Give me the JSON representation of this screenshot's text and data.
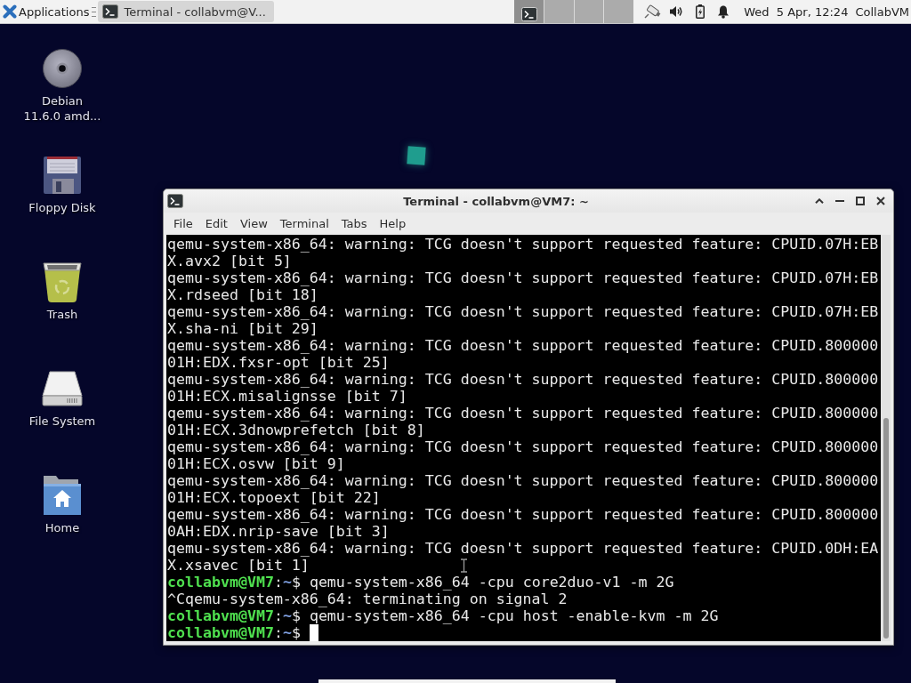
{
  "panel": {
    "menu": "Applications",
    "tasks": [
      {
        "label": "Terminal - collabvm@V...",
        "selected": true
      }
    ],
    "workspaces": [
      {
        "selected": true,
        "has_window": true
      },
      {
        "selected": false,
        "has_window": false
      },
      {
        "selected": false,
        "has_window": false
      },
      {
        "selected": false,
        "has_window": false
      }
    ],
    "clock": "Wed  5 Apr, 12:24",
    "user": "CollabVM"
  },
  "desktop_icons": [
    {
      "label": "Debian 11.6.0 amd...",
      "kind": "disc"
    },
    {
      "label": "Floppy Disk",
      "kind": "floppy"
    },
    {
      "label": "Trash",
      "kind": "trash"
    },
    {
      "label": "File System",
      "kind": "drive"
    },
    {
      "label": "Home",
      "kind": "home"
    }
  ],
  "terminal": {
    "title": "Terminal - collabvm@VM7: ~",
    "menu": [
      "File",
      "Edit",
      "View",
      "Terminal",
      "Tabs",
      "Help"
    ],
    "cursor": true,
    "lines": [
      {
        "kind": "output",
        "text": "qemu-system-x86_64: warning: TCG doesn't support requested feature: CPUID.07H:EB"
      },
      {
        "kind": "output",
        "text": "X.avx2 [bit 5]"
      },
      {
        "kind": "output",
        "text": "qemu-system-x86_64: warning: TCG doesn't support requested feature: CPUID.07H:EB"
      },
      {
        "kind": "output",
        "text": "X.rdseed [bit 18]"
      },
      {
        "kind": "output",
        "text": "qemu-system-x86_64: warning: TCG doesn't support requested feature: CPUID.07H:EB"
      },
      {
        "kind": "output",
        "text": "X.sha-ni [bit 29]"
      },
      {
        "kind": "output",
        "text": "qemu-system-x86_64: warning: TCG doesn't support requested feature: CPUID.800000"
      },
      {
        "kind": "output",
        "text": "01H:EDX.fxsr-opt [bit 25]"
      },
      {
        "kind": "output",
        "text": "qemu-system-x86_64: warning: TCG doesn't support requested feature: CPUID.800000"
      },
      {
        "kind": "output",
        "text": "01H:ECX.misalignsse [bit 7]"
      },
      {
        "kind": "output",
        "text": "qemu-system-x86_64: warning: TCG doesn't support requested feature: CPUID.800000"
      },
      {
        "kind": "output",
        "text": "01H:ECX.3dnowprefetch [bit 8]"
      },
      {
        "kind": "output",
        "text": "qemu-system-x86_64: warning: TCG doesn't support requested feature: CPUID.800000"
      },
      {
        "kind": "output",
        "text": "01H:ECX.osvw [bit 9]"
      },
      {
        "kind": "output",
        "text": "qemu-system-x86_64: warning: TCG doesn't support requested feature: CPUID.800000"
      },
      {
        "kind": "output",
        "text": "01H:ECX.topoext [bit 22]"
      },
      {
        "kind": "output",
        "text": "qemu-system-x86_64: warning: TCG doesn't support requested feature: CPUID.800000"
      },
      {
        "kind": "output",
        "text": "0AH:EDX.nrip-save [bit 3]"
      },
      {
        "kind": "output",
        "text": "qemu-system-x86_64: warning: TCG doesn't support requested feature: CPUID.0DH:EA"
      },
      {
        "kind": "output",
        "text": "X.xsavec [bit 1]"
      },
      {
        "kind": "prompt",
        "user": "collabvm@VM7",
        "sep": ":",
        "path": "~",
        "symbol": "$",
        "command": "qemu-system-x86_64 -cpu core2duo-v1 -m 2G"
      },
      {
        "kind": "output",
        "text": "^Cqemu-system-x86_64: terminating on signal 2"
      },
      {
        "kind": "prompt",
        "user": "collabvm@VM7",
        "sep": ":",
        "path": "~",
        "symbol": "$",
        "command": "qemu-system-x86_64 -cpu host -enable-kvm -m 2G"
      },
      {
        "kind": "prompt",
        "user": "collabvm@VM7",
        "sep": ":",
        "path": "~",
        "symbol": "$"
      }
    ]
  }
}
